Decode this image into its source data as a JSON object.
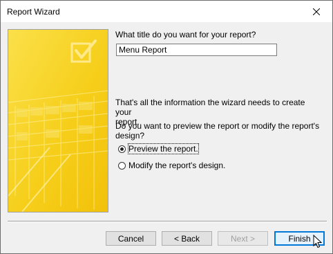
{
  "window": {
    "title": "Report Wizard"
  },
  "icons": {
    "close": "close-icon",
    "art": "checkbox-art-icon",
    "cursor": "mouse-pointer-icon"
  },
  "form": {
    "title_prompt": "What title do you want for your report?",
    "title_value": "Menu Report",
    "info_line1": "That's all the information the wizard needs to create your",
    "info_line2": "report.",
    "question_line1": "Do you want to preview the report or modify the report's",
    "question_line2": "design?",
    "options": [
      {
        "label": "Preview the report.",
        "selected": true
      },
      {
        "label": "Modify the report's design.",
        "selected": false
      }
    ]
  },
  "buttons": {
    "cancel": "Cancel",
    "back": "< Back",
    "next": "Next >",
    "finish": "Finish"
  },
  "colors": {
    "accent": "#0078d7",
    "art_yellow": "#f7d31e"
  }
}
